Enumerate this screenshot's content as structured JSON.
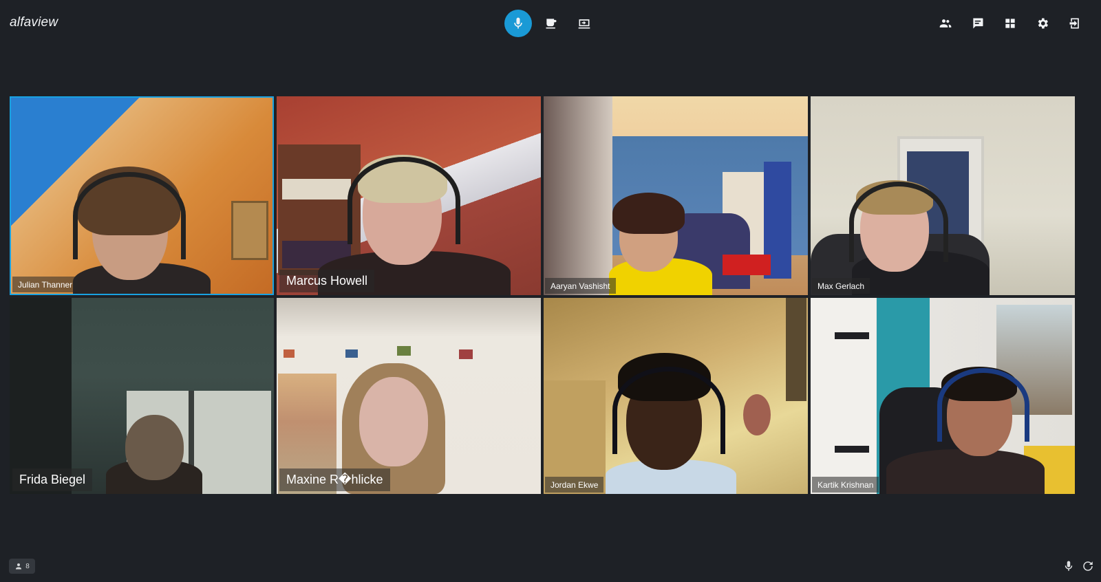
{
  "app": {
    "name": "alfaview"
  },
  "toolbar": {
    "center": [
      {
        "icon": "microphone-icon",
        "active": true
      },
      {
        "icon": "coffee-break-icon"
      },
      {
        "icon": "screen-share-icon"
      }
    ],
    "right": [
      {
        "icon": "participants-icon"
      },
      {
        "icon": "chat-icon"
      },
      {
        "icon": "layout-grid-icon"
      },
      {
        "icon": "settings-icon"
      },
      {
        "icon": "leave-icon"
      }
    ]
  },
  "participants": [
    {
      "name": "Julian Thanner",
      "active": true
    },
    {
      "name": "Marcus Howell"
    },
    {
      "name": "Aaryan Vashisht"
    },
    {
      "name": "Max Gerlach"
    },
    {
      "name": "Frida Biegel"
    },
    {
      "name": "Maxine R�hlicke"
    },
    {
      "name": "Jordan Ekwe"
    },
    {
      "name": "Kartik Krishnan"
    }
  ],
  "footer": {
    "participant_count": "8"
  },
  "colors": {
    "accent": "#1a9ad6",
    "background": "#1e2126"
  }
}
